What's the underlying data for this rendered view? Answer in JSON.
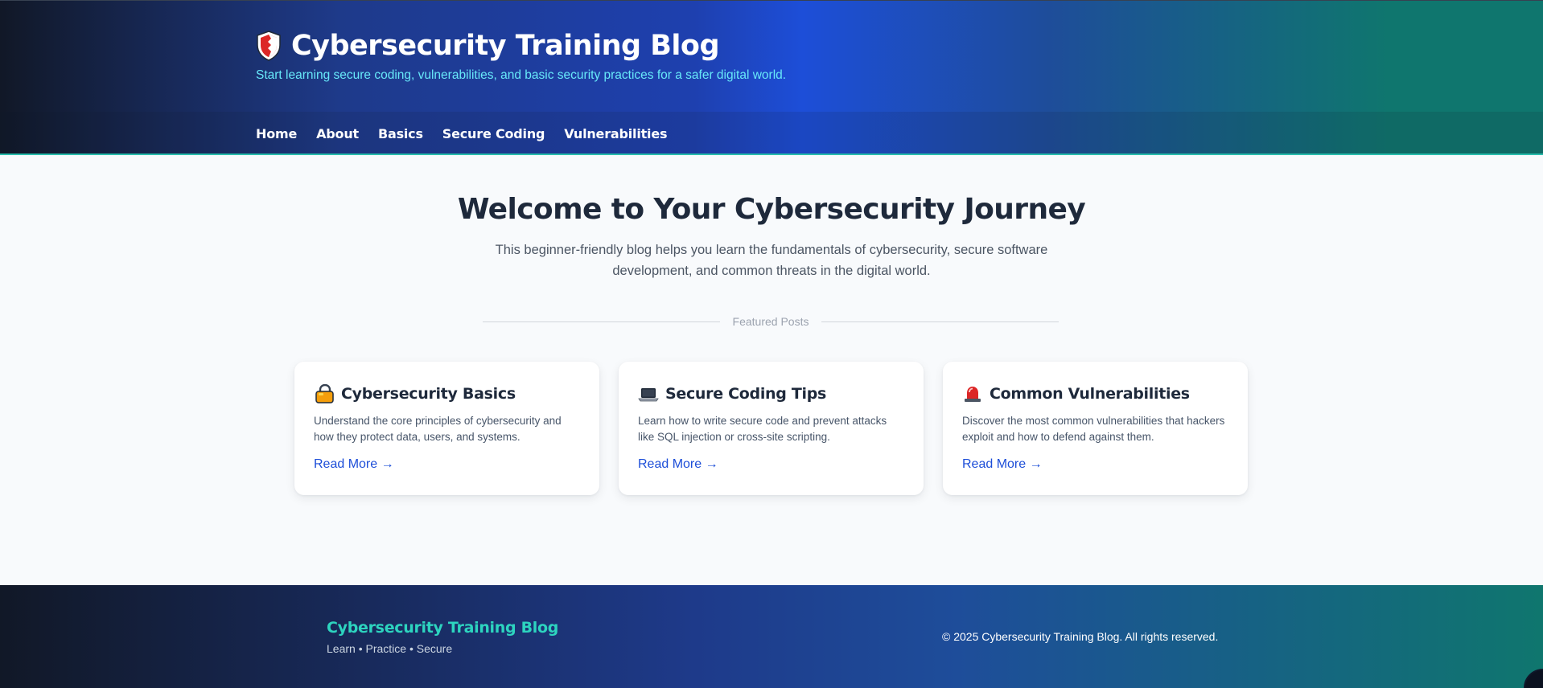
{
  "header": {
    "title": "Cybersecurity Training Blog",
    "tagline": "Start learning secure coding, vulnerabilities, and basic security practices for a safer digital world.",
    "logo_icon": "shield-icon",
    "nav": [
      {
        "label": "Home"
      },
      {
        "label": "About"
      },
      {
        "label": "Basics"
      },
      {
        "label": "Secure Coding"
      },
      {
        "label": "Vulnerabilities"
      }
    ]
  },
  "hero": {
    "title": "Welcome to Your Cybersecurity Journey",
    "description": "This beginner-friendly blog helps you learn the fundamentals of cybersecurity, secure software development, and common threats in the digital world."
  },
  "featured": {
    "label": "Featured Posts",
    "cards": [
      {
        "icon": "lock-icon",
        "title": "Cybersecurity Basics",
        "text": "Understand the core principles of cybersecurity and how they protect data, users, and systems.",
        "link": "Read More →"
      },
      {
        "icon": "laptop-icon",
        "title": "Secure Coding Tips",
        "text": "Learn how to write secure code and prevent attacks like SQL injection or cross-site scripting.",
        "link": "Read More →"
      },
      {
        "icon": "siren-icon",
        "title": "Common Vulnerabilities",
        "text": "Discover the most common vulnerabilities that hackers exploit and how to defend against them.",
        "link": "Read More →"
      }
    ]
  },
  "footer": {
    "title": "Cybersecurity Training Blog",
    "subtitle": "Learn • Practice • Secure",
    "copyright": "© 2025 Cybersecurity Training Blog. All rights reserved."
  },
  "colors": {
    "accent_teal": "#2dd4bf",
    "tagline_cyan": "#67e8f9",
    "link_blue": "#1d4ed8",
    "header_dark": "#111827",
    "header_blue": "#1d4ed8",
    "header_green": "#0f766e"
  }
}
